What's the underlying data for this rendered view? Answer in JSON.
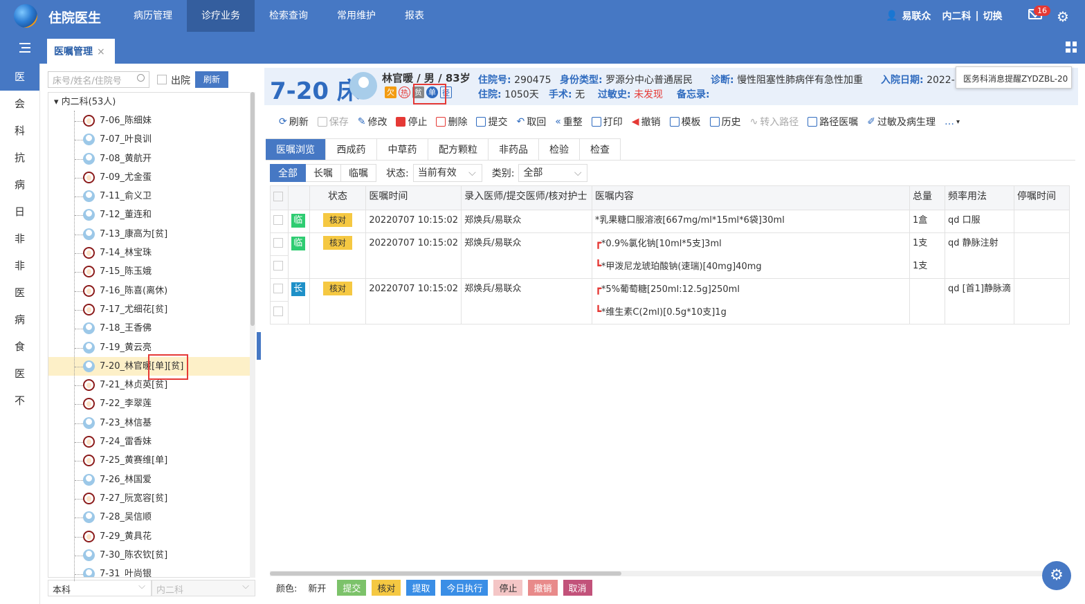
{
  "header": {
    "app_title": "住院医生",
    "nav": [
      "病历管理",
      "诊疗业务",
      "检索查询",
      "常用维护",
      "报表"
    ],
    "user": "易联众",
    "dept": "内二科",
    "switch": "切换",
    "mail_count": "16"
  },
  "tabs": {
    "active_tab": "医嘱管理",
    "close": "×"
  },
  "left_rail": [
    "医",
    "会",
    "科",
    "抗",
    "病",
    "日",
    "非",
    "非",
    "医",
    "病",
    "食",
    "医",
    "不"
  ],
  "patient_search": {
    "placeholder": "床号/姓名/住院号",
    "discharged_label": "出院",
    "refresh_label": "刷新"
  },
  "tree": {
    "root": "内二科(53人)",
    "patients": [
      {
        "label": "7-06_陈细妹",
        "sex": "f"
      },
      {
        "label": "7-07_叶良训",
        "sex": "m"
      },
      {
        "label": "7-08_黄航开",
        "sex": "m"
      },
      {
        "label": "7-09_尤金蛋",
        "sex": "f"
      },
      {
        "label": "7-11_俞义卫",
        "sex": "m"
      },
      {
        "label": "7-12_董连和",
        "sex": "m"
      },
      {
        "label": "7-13_康高为[贫]",
        "sex": "m"
      },
      {
        "label": "7-14_林宝珠",
        "sex": "f"
      },
      {
        "label": "7-15_陈玉娥",
        "sex": "f"
      },
      {
        "label": "7-16_陈喜(离休)",
        "sex": "f"
      },
      {
        "label": "7-17_尤细花[贫]",
        "sex": "f"
      },
      {
        "label": "7-18_王香佛",
        "sex": "m"
      },
      {
        "label": "7-19_黄云亮",
        "sex": "m"
      },
      {
        "label": "7-20_林官暖[单][贫]",
        "sex": "m"
      },
      {
        "label": "7-21_林贞英[贫]",
        "sex": "f"
      },
      {
        "label": "7-22_李翠莲",
        "sex": "f"
      },
      {
        "label": "7-23_林信基",
        "sex": "m"
      },
      {
        "label": "7-24_雷香妹",
        "sex": "f"
      },
      {
        "label": "7-25_黄赛维[单]",
        "sex": "f"
      },
      {
        "label": "7-26_林国爱",
        "sex": "m"
      },
      {
        "label": "7-27_阮宽容[贫]",
        "sex": "f"
      },
      {
        "label": "7-28_吴信顺",
        "sex": "m"
      },
      {
        "label": "7-29_黄具花",
        "sex": "f"
      },
      {
        "label": "7-30_陈农钦[贫]",
        "sex": "m"
      },
      {
        "label": "7-31_叶尚银",
        "sex": "m"
      }
    ]
  },
  "bottom_filters": {
    "scope": "本科",
    "dept": "内二科"
  },
  "patient": {
    "bed": "7-20 床",
    "name_line": "林官暖 / 男 / 83岁",
    "tags": [
      "欠",
      "热",
      "贫",
      "单",
      "径"
    ],
    "admission_no_label": "住院号:",
    "admission_no": "290475",
    "id_type_label": "身份类型:",
    "id_type": "罗源分中心普通居民",
    "diagnosis_label": "诊断:",
    "diagnosis": "慢性阻塞性肺病伴有急性加重",
    "admit_date_label": "入院日期:",
    "admit_date": "2022-",
    "stay_label": "住院:",
    "stay": "1050天",
    "surgery_label": "手术:",
    "surgery": "无",
    "allergy_label": "过敏史:",
    "allergy": "未发现",
    "memo_label": "备忘录:"
  },
  "tooltip": "医务科消息提醒ZYDZBL-20",
  "toolbar": [
    "刷新",
    "保存",
    "修改",
    "停止",
    "删除",
    "提交",
    "取回",
    "重整",
    "打印",
    "撤销",
    "模板",
    "历史",
    "转入路径",
    "路径医嘱",
    "过敏及病生理",
    "…"
  ],
  "order_tabs": [
    "医嘱浏览",
    "西成药",
    "中草药",
    "配方颗粒",
    "非药品",
    "检验",
    "检查"
  ],
  "filter": {
    "types": [
      "全部",
      "长嘱",
      "临嘱"
    ],
    "status_label": "状态:",
    "status": "当前有效",
    "category_label": "类别:",
    "category": "全部"
  },
  "table": {
    "headers": [
      "",
      "",
      "状态",
      "医嘱时间",
      "录入医师/提交医师/核对护士",
      "医嘱内容",
      "总量",
      "频率用法",
      "停嘱时间"
    ],
    "rows": [
      {
        "type": "临",
        "status": "核对",
        "time": "20220707 10:15:02",
        "doctors": "郑焕兵/易联众",
        "content": "*乳果糖口服溶液[667mg/ml*15ml*6袋]30ml",
        "qty": "1盒",
        "freq": "qd 口服"
      },
      {
        "type": "临",
        "status": "核对",
        "time": "20220707 10:15:02",
        "doctors": "郑焕兵/易联众",
        "content": "*0.9%氯化钠[10ml*5支]3ml",
        "qty": "1支",
        "freq": "qd 静脉注射"
      },
      {
        "type": "",
        "status": "",
        "time": "",
        "doctors": "",
        "content": "*甲泼尼龙琥珀酸钠(速瑞)[40mg]40mg",
        "qty": "1支",
        "freq": ""
      },
      {
        "type": "长",
        "status": "核对",
        "time": "20220707 10:15:02",
        "doctors": "郑焕兵/易联众",
        "content": "*5%葡萄糖[250ml:12.5g]250ml",
        "qty": "",
        "freq": "qd [首1]静脉滴"
      },
      {
        "type": "",
        "status": "",
        "time": "",
        "doctors": "",
        "content": "*维生素C(2ml)[0.5g*10支]1g",
        "qty": "",
        "freq": ""
      }
    ]
  },
  "legend": {
    "label": "颜色:",
    "items": [
      {
        "text": "新开",
        "bg": "#ffffff"
      },
      {
        "text": "提交",
        "bg": "#7cc26a"
      },
      {
        "text": "核对",
        "bg": "#f5c842"
      },
      {
        "text": "提取",
        "bg": "#3a8ee6"
      },
      {
        "text": "今日执行",
        "bg": "#3a8ee6"
      },
      {
        "text": "停止",
        "bg": "#f4c6c6"
      },
      {
        "text": "撤销",
        "bg": "#e88a8a"
      },
      {
        "text": "取消",
        "bg": "#c2527a"
      }
    ]
  }
}
